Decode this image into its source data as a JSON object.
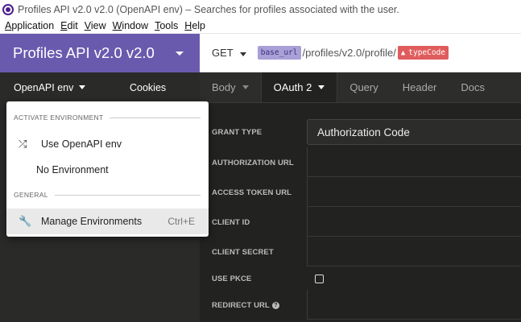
{
  "window": {
    "title": "Profiles API v2.0 v2.0 (OpenAPI env) – Searches for profiles associated with the user."
  },
  "menu": [
    "Application",
    "Edit",
    "View",
    "Window",
    "Tools",
    "Help"
  ],
  "workspace": {
    "name": "Profiles API v2.0 v2.0"
  },
  "request": {
    "method": "GET",
    "base_var": "base_url",
    "path": "/profiles/v2.0/profile/",
    "error_tag": "typeCode",
    "tabs": [
      "Body",
      "OAuth 2",
      "Query",
      "Header",
      "Docs"
    ]
  },
  "sidebar": {
    "env_label": "OpenAPI env",
    "cookies_label": "Cookies"
  },
  "env_dropdown": {
    "section_activate": "ACTIVATE ENVIRONMENT",
    "use_env": "Use OpenAPI env",
    "no_env": "No Environment",
    "section_general": "GENERAL",
    "manage": "Manage Environments",
    "manage_shortcut": "Ctrl+E"
  },
  "auth": {
    "grant_type_label": "GRANT TYPE",
    "grant_type_value": "Authorization Code",
    "authorization_url_label": "AUTHORIZATION URL",
    "access_token_url_label": "ACCESS TOKEN URL",
    "client_id_label": "CLIENT ID",
    "client_secret_label": "CLIENT SECRET",
    "use_pkce_label": "USE PKCE",
    "redirect_url_label": "REDIRECT URL"
  },
  "colors": {
    "brand": "#6a5aae",
    "error": "#e05c5c",
    "variable": "#a9a0d8"
  }
}
